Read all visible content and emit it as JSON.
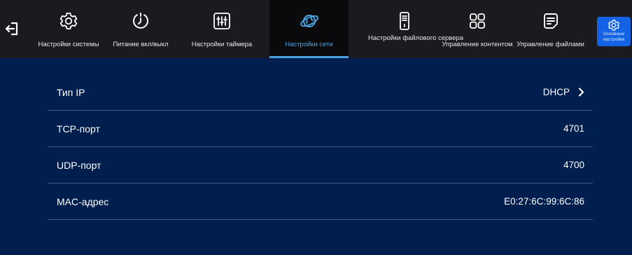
{
  "toolbar": {
    "back_icon": "exit-arrow-icon",
    "tabs": [
      {
        "label": "Настройки системы",
        "icon": "gear-icon"
      },
      {
        "label": "Питание вкл/выкл",
        "icon": "power-clock-icon"
      },
      {
        "label": "Настройки таймера",
        "icon": "sliders-icon"
      },
      {
        "label": "Настройки сети",
        "icon": "globe-icon",
        "active": true
      },
      {
        "label": "Настройки файлового сервера",
        "icon": "server-icon"
      },
      {
        "label": "Управление контентом",
        "icon": "grid-icon"
      },
      {
        "label": "Управление файлами",
        "icon": "document-icon"
      }
    ],
    "basic_settings": {
      "label": "Основные настройки",
      "icon": "gear-icon"
    }
  },
  "network": {
    "rows": [
      {
        "key": "Тип IP",
        "value": "DHCP",
        "has_arrow": true
      },
      {
        "key": "TCP-порт",
        "value": "4701"
      },
      {
        "key": "UDP-порт",
        "value": "4700"
      },
      {
        "key": "MAC-адрес",
        "value": "E0:27:6C:99:6C:86"
      }
    ]
  },
  "colors": {
    "content_bg": "#001f4e",
    "toolbar_bg": "#1b1b1f",
    "accent": "#4aa3e0",
    "basic_button": "#1463e6"
  }
}
